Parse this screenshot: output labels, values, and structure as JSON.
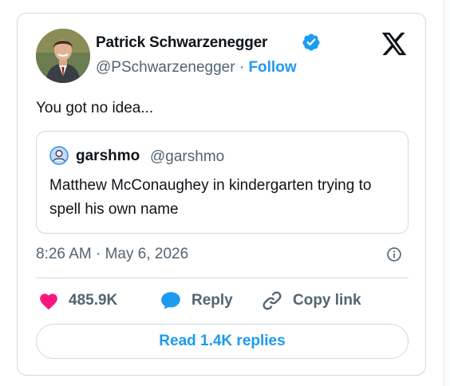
{
  "author": {
    "name": "Patrick Schwarzenegger",
    "handle": "@PSchwarzenegger",
    "separator": "·",
    "follow_label": "Follow",
    "verified": true
  },
  "tweet": {
    "text": "You got no idea...",
    "timestamp": "8:26 AM · May 6, 2026"
  },
  "quoted": {
    "name": "garshmo",
    "handle": "@garshmo",
    "text": "Matthew McConaughey in kindergarten trying to spell his own name"
  },
  "actions": {
    "likes": "485.9K",
    "reply_label": "Reply",
    "copy_label": "Copy link"
  },
  "read_replies_label": "Read 1.4K replies",
  "colors": {
    "accent": "#1d9bf0",
    "like": "#f91880",
    "secondary_text": "#536471",
    "border": "#cfd9de"
  },
  "icons": {
    "brand": "x-logo-icon",
    "verified": "verified-badge-icon",
    "like": "heart-icon",
    "reply": "reply-bubble-icon",
    "copy": "link-icon",
    "info": "info-icon"
  }
}
